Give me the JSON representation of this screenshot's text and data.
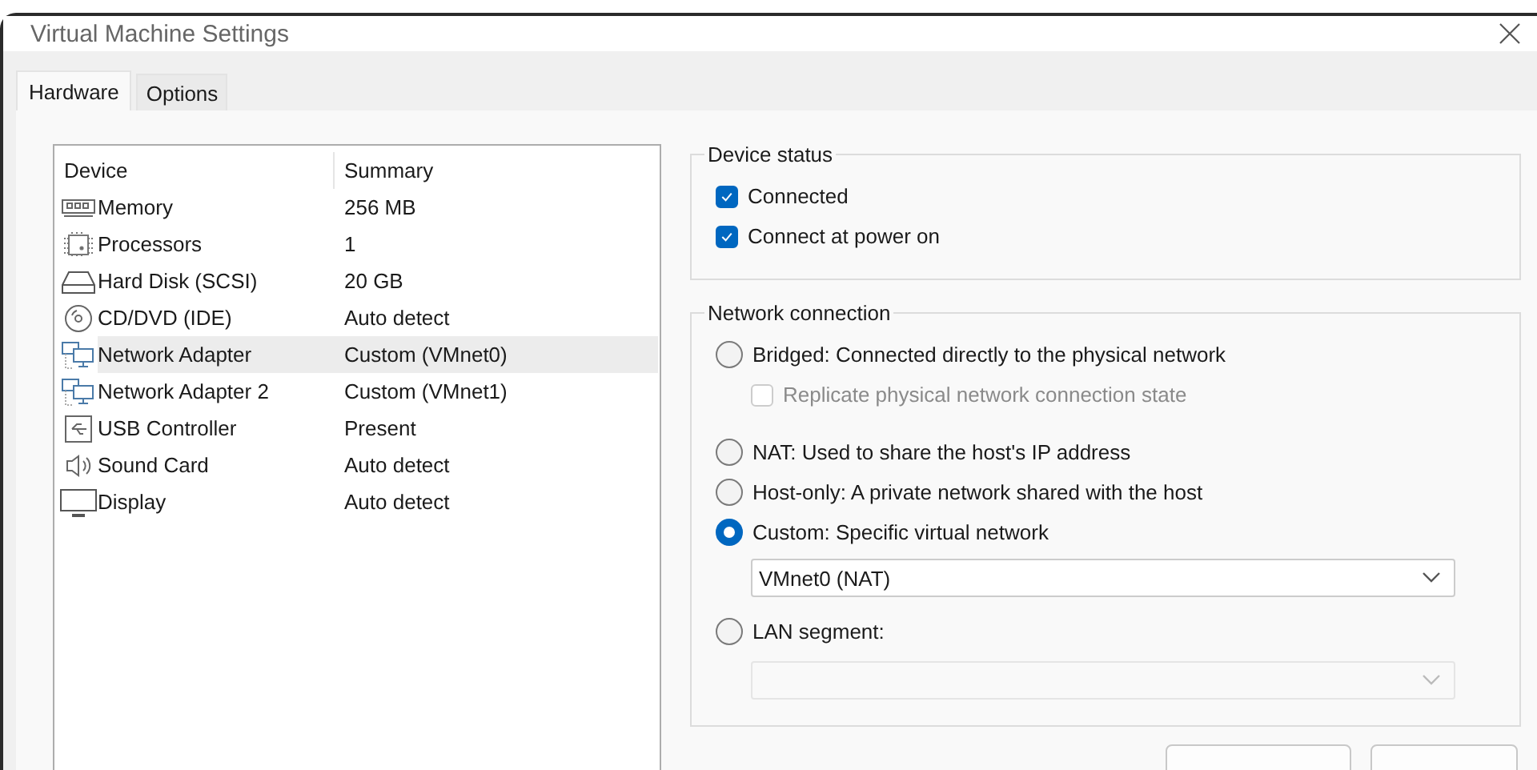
{
  "window": {
    "title": "Virtual Machine Settings"
  },
  "tabs": [
    {
      "label": "Hardware",
      "selected": true
    },
    {
      "label": "Options",
      "selected": false
    }
  ],
  "device_list": {
    "columns": [
      "Device",
      "Summary"
    ],
    "rows": [
      {
        "kind": "memory",
        "device": "Memory",
        "summary": "256 MB",
        "selected": false
      },
      {
        "kind": "processor",
        "device": "Processors",
        "summary": "1",
        "selected": false
      },
      {
        "kind": "disk",
        "device": "Hard Disk (SCSI)",
        "summary": "20 GB",
        "selected": false
      },
      {
        "kind": "cd",
        "device": "CD/DVD (IDE)",
        "summary": "Auto detect",
        "selected": false
      },
      {
        "kind": "network",
        "device": "Network Adapter",
        "summary": "Custom (VMnet0)",
        "selected": true
      },
      {
        "kind": "network",
        "device": "Network Adapter 2",
        "summary": "Custom (VMnet1)",
        "selected": false
      },
      {
        "kind": "usb",
        "device": "USB Controller",
        "summary": "Present",
        "selected": false
      },
      {
        "kind": "sound",
        "device": "Sound Card",
        "summary": "Auto detect",
        "selected": false
      },
      {
        "kind": "display",
        "device": "Display",
        "summary": "Auto detect",
        "selected": false
      }
    ]
  },
  "device_status": {
    "title": "Device status",
    "options": [
      {
        "label": "Connected",
        "checked": true
      },
      {
        "label": "Connect at power on",
        "checked": true
      }
    ]
  },
  "network_connection": {
    "title": "Network connection",
    "items": [
      {
        "kind": "radio",
        "label": "Bridged: Connected directly to the physical network",
        "selected": false
      },
      {
        "kind": "checkbox",
        "label": "Replicate physical network connection state",
        "checked": false,
        "disabled": true
      },
      {
        "kind": "radio",
        "label": "NAT: Used to share the host's IP address",
        "selected": false
      },
      {
        "kind": "radio",
        "label": "Host-only: A private network shared with the host",
        "selected": false
      },
      {
        "kind": "radio",
        "label": "Custom: Specific virtual network",
        "selected": true
      },
      {
        "kind": "dropdown",
        "value": "VMnet0 (NAT)",
        "disabled": false
      },
      {
        "kind": "radio",
        "label": "LAN segment:",
        "selected": false
      },
      {
        "kind": "dropdown",
        "disabled": true
      }
    ]
  }
}
